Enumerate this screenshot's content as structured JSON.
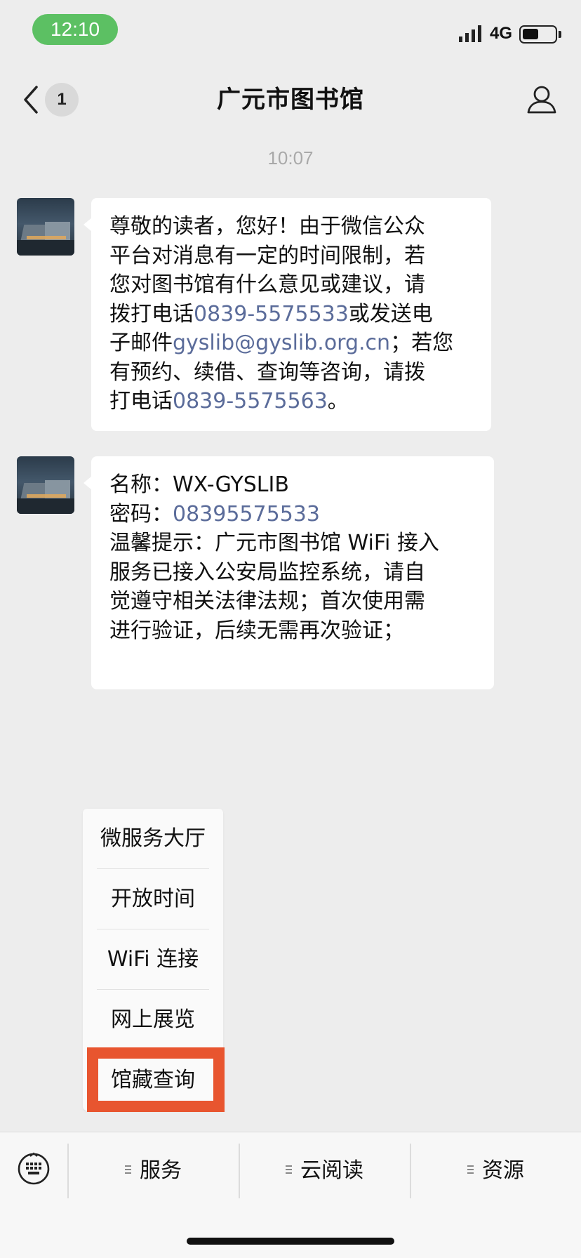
{
  "status": {
    "time": "12:10",
    "network": "4G"
  },
  "nav": {
    "unread_count": "1",
    "title": "广元市图书馆"
  },
  "chat": {
    "timestamp": "10:07",
    "messages": [
      {
        "lines": [
          {
            "parts": [
              {
                "t": "尊敬的读者，您好！由于微信公众"
              }
            ]
          },
          {
            "parts": [
              {
                "t": "平台对消息有一定的时间限制，若"
              }
            ]
          },
          {
            "parts": [
              {
                "t": "您对图书馆有什么意见或建议，请"
              }
            ]
          },
          {
            "parts": [
              {
                "t": "拨打电话"
              },
              {
                "t": "0839-5575533",
                "link": true
              },
              {
                "t": "或发送电"
              }
            ]
          },
          {
            "parts": [
              {
                "t": "子邮件"
              },
              {
                "t": "gyslib@gyslib.org.cn",
                "link": true
              },
              {
                "t": "；若您"
              }
            ]
          },
          {
            "parts": [
              {
                "t": "有预约、续借、查询等咨询，请拨"
              }
            ]
          },
          {
            "parts": [
              {
                "t": "打电话"
              },
              {
                "t": "0839-5575563",
                "link": true
              },
              {
                "t": "。"
              }
            ]
          }
        ]
      },
      {
        "lines": [
          {
            "parts": [
              {
                "t": "名称：WX-GYSLIB"
              }
            ]
          },
          {
            "parts": [
              {
                "t": "密码："
              },
              {
                "t": "08395575533",
                "link": true
              }
            ]
          },
          {
            "parts": [
              {
                "t": "温馨提示：广元市图书馆 WiFi 接入"
              }
            ]
          },
          {
            "parts": [
              {
                "t": "服务已接入公安局监控系统，请自"
              }
            ]
          },
          {
            "parts": [
              {
                "t": "觉遵守相关法律法规；首次使用需"
              }
            ]
          },
          {
            "parts": [
              {
                "t": "进行验证，后续无需再次验证；"
              }
            ]
          }
        ]
      }
    ]
  },
  "menu": {
    "items": [
      "微服务大厅",
      "开放时间",
      "WiFi 连接",
      "网上展览",
      "馆藏查询"
    ],
    "highlighted_index": 4
  },
  "bottom_bar": {
    "tabs": [
      "服务",
      "云阅读",
      "资源"
    ]
  },
  "colors": {
    "link": "#5b6c9a",
    "highlight": "#e8552f",
    "time_pill": "#5cc063"
  },
  "icons": [
    "signal-icon",
    "battery-icon",
    "back-chevron-icon",
    "profile-icon",
    "keyboard-icon",
    "menu-lines-icon"
  ]
}
